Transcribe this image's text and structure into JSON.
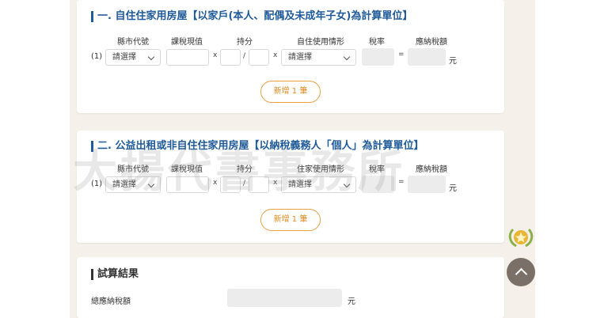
{
  "section1": {
    "title": "一. 自住住家用房屋【以家戶(本人、配偶及未成年子女)為計算單位】",
    "columns": [
      "縣市代號",
      "課稅現值",
      "持分",
      "自住使用情形",
      "稅率",
      "應納稅額"
    ],
    "row": {
      "index": "(1)",
      "county_select": "請選擇",
      "usage_select": "請選擇",
      "times_symbol": "x",
      "slash_symbol": "/",
      "equals_symbol": "=",
      "unit": "元"
    },
    "add_button": "新增 1 筆"
  },
  "section2": {
    "title": "二. 公益出租或非自住住家用房屋【以納稅義務人「個人」為計算單位】",
    "columns": [
      "縣市代號",
      "課稅現值",
      "持分",
      "住家使用情形",
      "稅率",
      "應納稅額"
    ],
    "row": {
      "index": "(1)",
      "county_select": "請選擇",
      "usage_select": "請選擇",
      "times_symbol": "x",
      "slash_symbol": "/",
      "equals_symbol": "=",
      "unit": "元"
    },
    "add_button": "新增 1 筆"
  },
  "section3": {
    "title": "試算結果",
    "total_label": "總應納稅額",
    "unit": "元"
  },
  "watermark": "大揚代書事務所",
  "colors": {
    "title_blue": "#1f5a99",
    "button_orange": "#e8a044",
    "page_bg": "#f5f0ea",
    "readonly_gray": "#ececec",
    "scroll_button": "#7a7068"
  },
  "icons": {
    "badge": "star-laurel-icon",
    "scroll": "chevron-up-icon"
  }
}
